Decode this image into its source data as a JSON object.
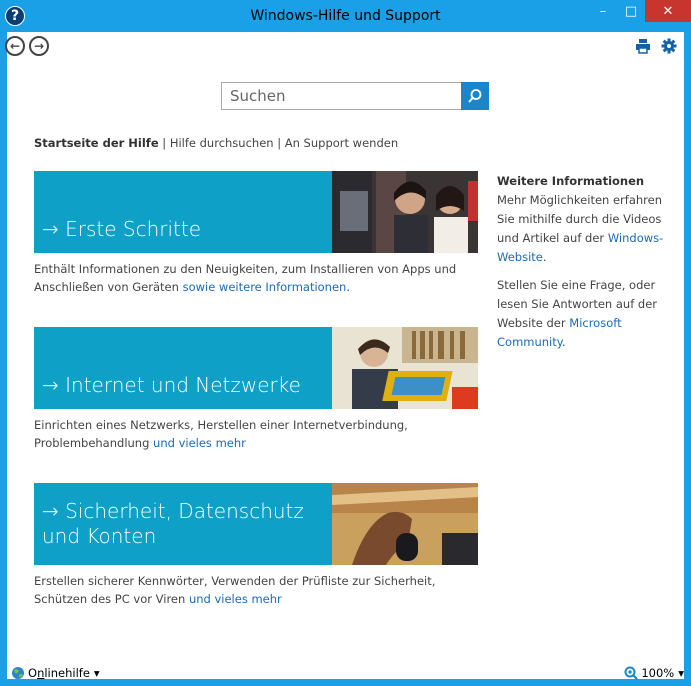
{
  "window": {
    "title": "Windows-Hilfe und Support",
    "help_glyph": "?",
    "minimize_glyph": "–",
    "maximize_glyph": "□",
    "close_glyph": "✕",
    "accent": "#1aa0e6"
  },
  "toolbar": {
    "back_glyph": "←",
    "forward_glyph": "→",
    "print_icon": "printer-icon",
    "settings_icon": "gear-icon"
  },
  "search": {
    "placeholder": "Suchen",
    "value": "",
    "button_icon": "search-icon",
    "button_color": "#1a86c9"
  },
  "breadcrumb": {
    "home": "Startseite der Hilfe",
    "sep": "|",
    "search": "Hilfe durchsuchen",
    "support": "An Support wenden"
  },
  "tiles": [
    {
      "label": "→ Erste Schritte",
      "desc": "Enthält Informationen zu den Neuigkeiten, zum Installieren von Apps und Anschließen von Geräten",
      "link": "sowie weitere Informationen",
      "after": "."
    },
    {
      "label": "→ Internet und Netzwerke",
      "desc": "Einrichten eines Netzwerks, Herstellen einer Internetverbindung, Problembehandlung",
      "link": "und vieles mehr",
      "after": ""
    },
    {
      "label_line1": "→ Sicherheit, Datenschutz",
      "label_line2": "und Konten",
      "desc": "Erstellen sicherer Kennwörter, Verwenden der Prüfliste zur Sicherheit, Schützen des PC vor Viren",
      "link": "und vieles mehr",
      "after": ""
    }
  ],
  "tile_color": "#0fa0c8",
  "sidebar": {
    "heading": "Weitere Informationen",
    "p1_text": "Mehr Möglichkeiten erfahren Sie mithilfe durch die Videos und Artikel auf der",
    "p1_link": "Windows-Website",
    "p1_after": ".",
    "p2_text": "Stellen Sie eine Frage, oder lesen Sie Antworten auf der Website der",
    "p2_link": "Microsoft Community",
    "p2_after": "."
  },
  "status": {
    "online_label_prefix": "O",
    "online_label_underline": "n",
    "online_label_suffix": "linehilfe",
    "dropdown_glyph": "▾",
    "zoom": "100%"
  }
}
